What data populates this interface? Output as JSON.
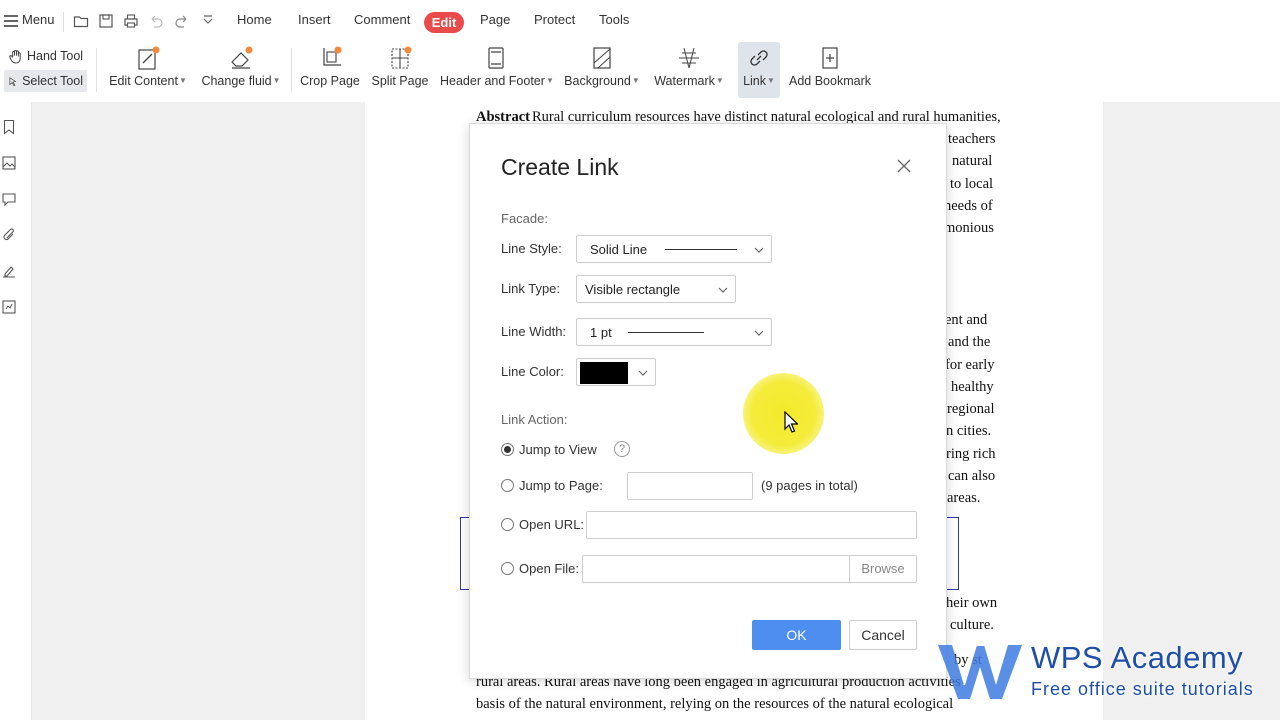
{
  "menubar": {
    "menu_label": "Menu",
    "tabs": [
      "Home",
      "Insert",
      "Comment",
      "Edit",
      "Page",
      "Protect",
      "Tools"
    ]
  },
  "ribbon": {
    "hand_tool": "Hand Tool",
    "select_tool": "Select Tool",
    "edit_content": "Edit Content",
    "change_fluid": "Change fluid",
    "crop_page": "Crop Page",
    "split_page": "Split Page",
    "header_footer": "Header and Footer",
    "background": "Background",
    "watermark": "Watermark",
    "link": "Link",
    "add_bookmark": "Add Bookmark"
  },
  "document": {
    "lines_top": [
      "Rural curriculum resources have distinct natural ecological and rural humanities,",
      "teachers",
      "natural",
      "to local",
      "needs of",
      "monious"
    ],
    "abstract_label": "Abstract",
    "lines_mid": [
      "ent  and",
      "and the",
      "for early",
      "healthy",
      "regional",
      "n  cities.",
      "ring rich",
      "can also",
      "areas."
    ],
    "lines_bottom_right": [
      "heir own",
      "culture.",
      "by  st"
    ],
    "line_b1": "rural areas. Rural areas have long been engaged in agricultural production activities",
    "line_b2": "basis of the natural environment, relying on the resources of the natural ecological"
  },
  "dialog": {
    "title": "Create Link",
    "facade_label": "Facade:",
    "line_style_label": "Line Style:",
    "line_style_value": "Solid Line",
    "link_type_label": "Link Type:",
    "link_type_value": "Visible rectangle",
    "line_width_label": "Line Width:",
    "line_width_value": "1 pt",
    "line_color_label": "Line Color:",
    "line_color_value": "#000000",
    "link_action_label": "Link Action:",
    "jump_to_view": "Jump to View",
    "jump_to_page": "Jump to Page:",
    "page_input_value": "",
    "pages_total": "(9 pages in total)",
    "open_url": "Open URL:",
    "url_value": "",
    "open_file": "Open File:",
    "file_value": "",
    "browse": "Browse",
    "ok": "OK",
    "cancel": "Cancel",
    "selected_action": "jump_to_view"
  },
  "watermark": {
    "title": "WPS Academy",
    "subtitle": "Free office suite tutorials"
  },
  "colors": {
    "edit_tab": "#e94b4b",
    "ok_button": "#4d8ef0",
    "link_rect": "#2c3aa6",
    "cursor_highlight": "#f3ea2c",
    "brand": "#1f4fa8"
  }
}
